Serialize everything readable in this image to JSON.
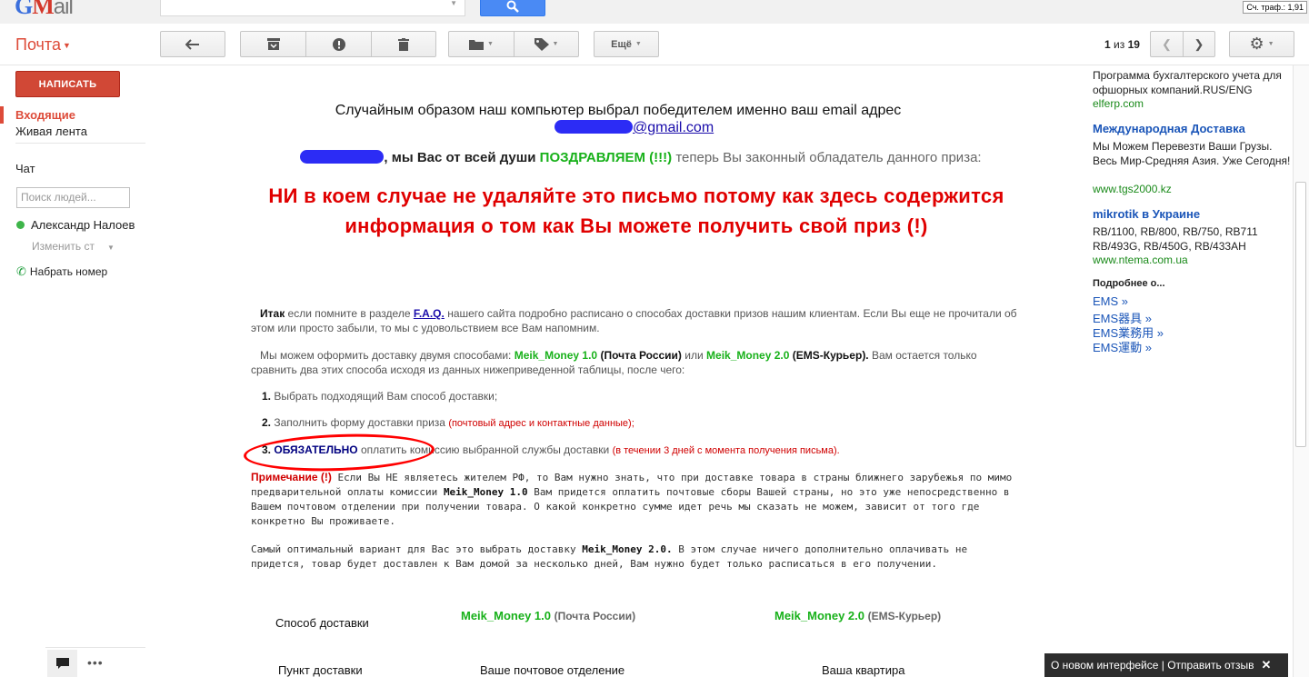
{
  "app": {
    "logo_g": "G",
    "logo_m": "M",
    "logo_rest": "ail",
    "traffic_counter": "Сч. траф.: 1,91"
  },
  "toolbar": {
    "mail_label": "Почта",
    "more_label": "Ещё",
    "pager_current": "1",
    "pager_of": "из",
    "pager_total": "19"
  },
  "nav": {
    "compose": "НАПИСАТЬ",
    "inbox": "Входящие",
    "feed": "Живая лента",
    "chat_title": "Чат",
    "people_search_placeholder": "Поиск людей...",
    "contact_name": "Александр Налоев",
    "status_label": "Изменить ст",
    "call_label": "Набрать номер"
  },
  "message": {
    "line1": "Случайным образом наш компьютер выбрал победителем именно ваш email адрес",
    "email_suffix": "@gmail.com",
    "line3_pre": ", мы Вас от всей души",
    "congrats": "ПОЗДРАВЛЯЕМ (!!!)",
    "line3_post": "теперь Вы законный обладатель данного приза:",
    "warning": "НИ в коем случае не удаляйте это письмо потому как здесь содержится информация о том как Вы можете получить свой приз (!)",
    "p1_bold": "Итак",
    "p1_a": "если помните в разделе",
    "p1_link": "F.A.Q.",
    "p1_b": "нашего сайта подробно расписано о способах доставки призов нашим клиентам. Если Вы еще не прочитали об этом или просто забыли, то мы с удовольствием все Вам напомним.",
    "p2_a": "Мы можем оформить доставку двумя способами:",
    "p2_m1": "Meik_Money 1.0",
    "p2_m1b": "(Почта России)",
    "p2_or": "или",
    "p2_m2": "Meik_Money 2.0",
    "p2_m2b": "(EMS-Курьер).",
    "p2_b": "Вам остается только сравнить два этих способа исходя из данных нижеприведенной таблицы, после чего:",
    "s1_n": "1.",
    "s1": "Выбрать подходящий Вам способ доставки;",
    "s2_n": "2.",
    "s2": "Заполнить форму доставки приза",
    "s2_red": "(почтовый адрес и контактные данные);",
    "s3_n": "3.",
    "s3_bold": "ОБЯЗАТЕЛЬНО",
    "s3": "оплатить комиссию выбранной службы доставки",
    "s3_red": "(в течении 3 дней с момента получения письма).",
    "note_label": "Примечание (!)",
    "note_a": "Если Вы НЕ являетесь жителем РФ, то Вам нужно знать, что при доставке товара в страны ближнего зарубежья по мимо предварительной оплаты комиссии",
    "note_m": "Meik_Money 1.0",
    "note_b": "Вам придется оплатить почтовые сборы Вашей страны, но это уже непосредственно в Вашем почтовом отделении при получении товара. О какой конкретно сумме идет речь мы сказать не можем, зависит от того где конкретно Вы проживаете.",
    "opt_a": "Самый оптимальный вариант для Вас это выбрать доставку",
    "opt_m": "Meik_Money 2.0.",
    "opt_b": "В этом случае ничего дополнительно оплачивать не придется, товар будет доставлен к Вам домой за несколько дней, Вам нужно будет только расписаться в его получении."
  },
  "table": {
    "row1_label": "Способ доставки",
    "col1_name": "Meik_Money 1.0",
    "col1_sub": "(Почта России)",
    "col2_name": "Meik_Money 2.0",
    "col2_sub": "(EMS-Курьер)",
    "row2_label": "Пункт доставки",
    "row2_c1": "Ваше почтовое отделение",
    "row2_c2": "Ваша квартира"
  },
  "ads": {
    "a1_text": "Программа бухгалтерского учета для офшорных компаний.RUS/ENG",
    "a1_url": "elferp.com",
    "a2_title": "Международная Доставка",
    "a2_text": "Мы Можем Перевезти Ваши Грузы. Весь Мир-Средняя Азия. Уже Сегодня!",
    "a2_url": "www.tgs2000.kz",
    "a3_title": "mikrotik в Украине",
    "a3_text": "RB/1100, RB/800, RB/750, RB711 RB/493G, RB/450G, RB/433AH",
    "a3_url": "www.ntema.com.ua",
    "more_about": "Подробнее о...",
    "ems1": "EMS »",
    "ems2": "EMS器具 »",
    "ems3": "EMS業務用 »",
    "ems4": "EMS運動 »"
  },
  "footer": {
    "feedback": "О новом интерфейсе | Отправить отзыв",
    "close": "✕"
  },
  "colors": {
    "accent_red": "#dd4b39",
    "search_blue": "#4a8af4",
    "prize_green": "#18b11a",
    "warning_red": "#e00000"
  }
}
